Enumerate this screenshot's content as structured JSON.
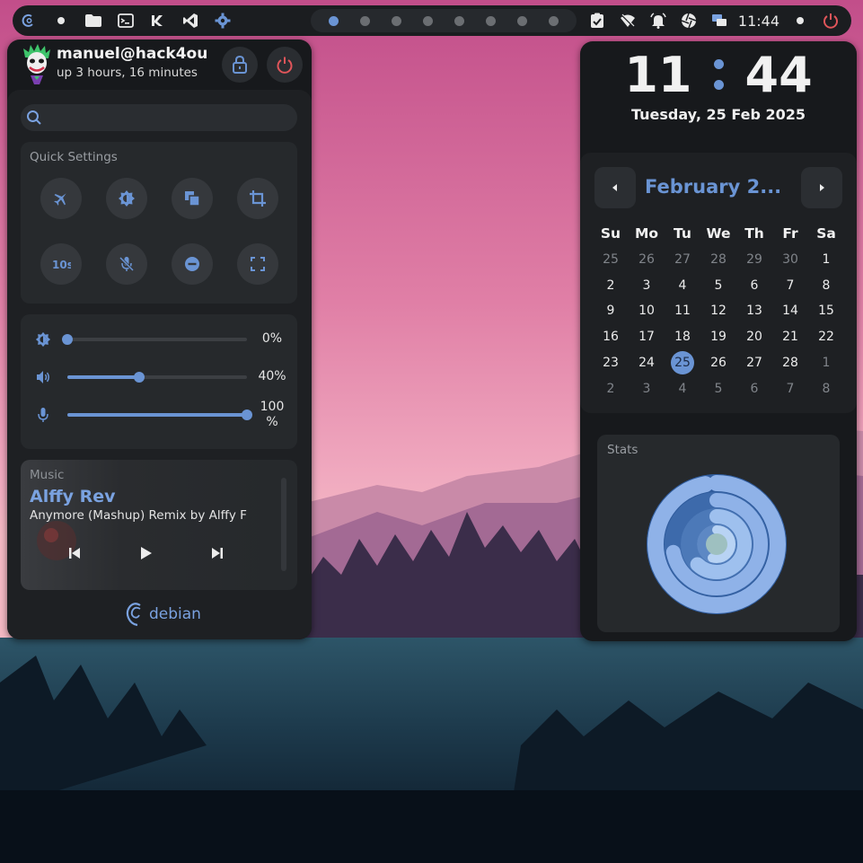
{
  "topbar": {
    "workspaces": [
      {
        "active": true
      },
      {
        "active": false
      },
      {
        "active": false
      },
      {
        "active": false
      },
      {
        "active": false
      },
      {
        "active": false
      },
      {
        "active": false
      },
      {
        "active": false
      }
    ],
    "time": "11:44"
  },
  "profile": {
    "user": "manuel@hack4ou",
    "uptime": "up 3 hours, 16 minutes"
  },
  "search": {
    "placeholder": "",
    "value": ""
  },
  "quick_settings": {
    "title": "Quick Settings",
    "buttons": [
      {
        "name": "airplane-mode",
        "icon": "airplane-icon"
      },
      {
        "name": "night-light",
        "icon": "brightness-icon"
      },
      {
        "name": "screenshot-window",
        "icon": "window-icon"
      },
      {
        "name": "screenshot-region",
        "icon": "crop-icon"
      },
      {
        "name": "timer-10s",
        "icon": "timer-10s-icon"
      },
      {
        "name": "mute-microphone",
        "icon": "mic-off-icon"
      },
      {
        "name": "do-not-disturb",
        "icon": "minus-circle-icon"
      },
      {
        "name": "fullscreen",
        "icon": "fullscreen-icon"
      }
    ]
  },
  "sliders": {
    "brightness": {
      "value": 0,
      "label": "0%"
    },
    "volume": {
      "value": 40,
      "label": "40%"
    },
    "microphone": {
      "value": 100,
      "label": "100\n%"
    }
  },
  "music": {
    "title": "Music",
    "song": "Alffy Rev",
    "artist": "Anymore (Mashup) Remix by Alffy F"
  },
  "distro": "debian",
  "clock": {
    "hours": "11",
    "minutes": "44",
    "date": "Tuesday, 25 Feb 2025"
  },
  "calendar": {
    "month": "February 2...",
    "weekdays": [
      "Su",
      "Mo",
      "Tu",
      "We",
      "Th",
      "Fr",
      "Sa"
    ],
    "days": [
      {
        "d": "25",
        "dim": true
      },
      {
        "d": "26",
        "dim": true
      },
      {
        "d": "27",
        "dim": true
      },
      {
        "d": "28",
        "dim": true
      },
      {
        "d": "29",
        "dim": true
      },
      {
        "d": "30",
        "dim": true
      },
      {
        "d": "1"
      },
      {
        "d": "2"
      },
      {
        "d": "3"
      },
      {
        "d": "4"
      },
      {
        "d": "5"
      },
      {
        "d": "6"
      },
      {
        "d": "7"
      },
      {
        "d": "8"
      },
      {
        "d": "9"
      },
      {
        "d": "10"
      },
      {
        "d": "11"
      },
      {
        "d": "12"
      },
      {
        "d": "13"
      },
      {
        "d": "14"
      },
      {
        "d": "15"
      },
      {
        "d": "16"
      },
      {
        "d": "17"
      },
      {
        "d": "18"
      },
      {
        "d": "19"
      },
      {
        "d": "20"
      },
      {
        "d": "21"
      },
      {
        "d": "22"
      },
      {
        "d": "23"
      },
      {
        "d": "24"
      },
      {
        "d": "25",
        "today": true
      },
      {
        "d": "26"
      },
      {
        "d": "27"
      },
      {
        "d": "28"
      },
      {
        "d": "1",
        "dim": true
      },
      {
        "d": "2",
        "dim": true
      },
      {
        "d": "3",
        "dim": true
      },
      {
        "d": "4",
        "dim": true
      },
      {
        "d": "5",
        "dim": true
      },
      {
        "d": "6",
        "dim": true
      },
      {
        "d": "7",
        "dim": true
      },
      {
        "d": "8",
        "dim": true
      }
    ]
  },
  "stats": {
    "title": "Stats",
    "rings": [
      {
        "value": 0.97,
        "color": "#8fb2e8"
      },
      {
        "value": 0.72,
        "color": "#8fb2e8"
      },
      {
        "value": 0.62,
        "color": "#9ec0ee"
      },
      {
        "value": 0.55,
        "color": "#b8d3f4"
      }
    ]
  },
  "colors": {
    "accent": "#6a94d4",
    "panel": "#17191c",
    "danger": "#e0555a"
  }
}
